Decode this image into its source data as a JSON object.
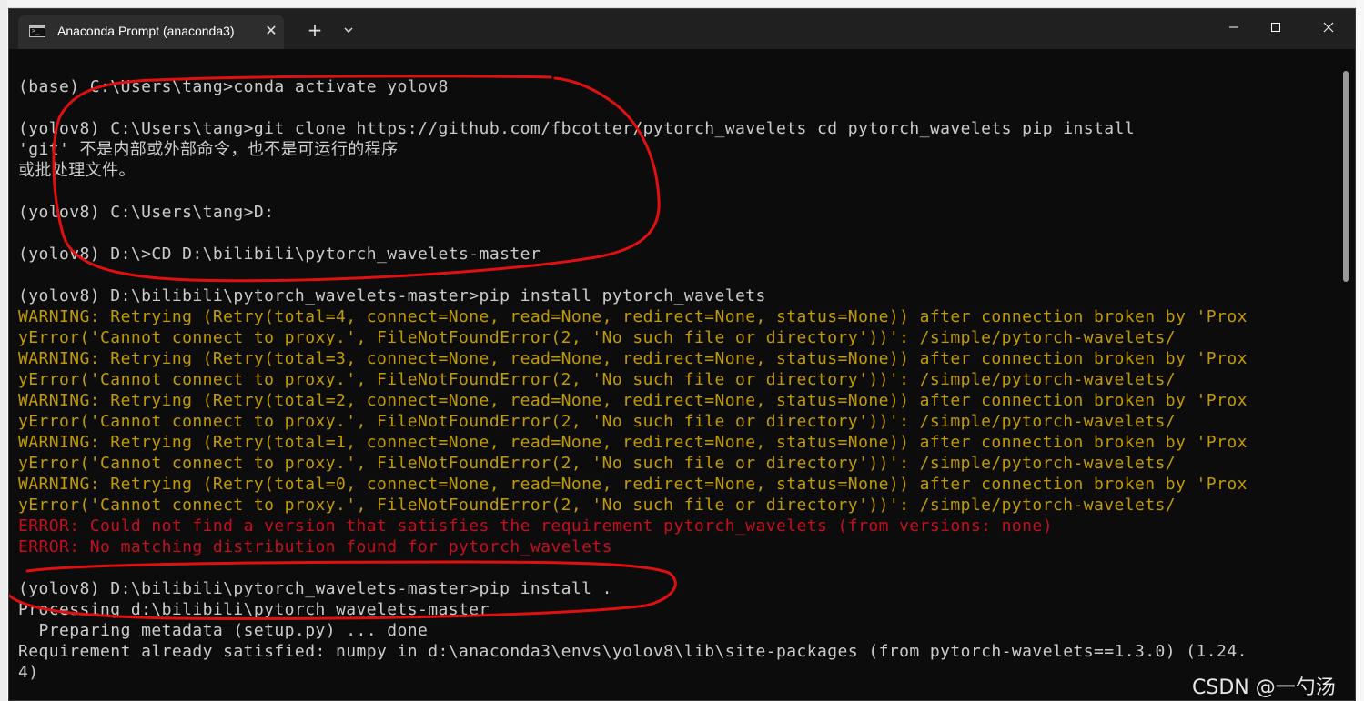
{
  "window": {
    "tab_title": "Anaconda Prompt (anaconda3)",
    "tab_close": "✕",
    "new_tab": "+",
    "minimize": "─",
    "maximize": "☐",
    "close": "✕"
  },
  "terminal_lines": [
    {
      "text": "(base) C:\\Users\\tang>conda activate yolov8",
      "type": "normal"
    },
    {
      "text": "",
      "type": "normal"
    },
    {
      "text": "(yolov8) C:\\Users\\tang>git clone https://github.com/fbcotter/pytorch_wavelets cd pytorch_wavelets pip install",
      "type": "normal"
    },
    {
      "text": "'git' 不是内部或外部命令，也不是可运行的程序",
      "type": "normal"
    },
    {
      "text": "或批处理文件。",
      "type": "normal"
    },
    {
      "text": "",
      "type": "normal"
    },
    {
      "text": "(yolov8) C:\\Users\\tang>D:",
      "type": "normal"
    },
    {
      "text": "",
      "type": "normal"
    },
    {
      "text": "(yolov8) D:\\>CD D:\\bilibili\\pytorch_wavelets-master",
      "type": "normal"
    },
    {
      "text": "",
      "type": "normal"
    },
    {
      "text": "(yolov8) D:\\bilibili\\pytorch_wavelets-master>pip install pytorch_wavelets",
      "type": "normal"
    },
    {
      "text": "WARNING: Retrying (Retry(total=4, connect=None, read=None, redirect=None, status=None)) after connection broken by 'Prox",
      "type": "warn"
    },
    {
      "text": "yError('Cannot connect to proxy.', FileNotFoundError(2, 'No such file or directory'))': /simple/pytorch-wavelets/",
      "type": "warn"
    },
    {
      "text": "WARNING: Retrying (Retry(total=3, connect=None, read=None, redirect=None, status=None)) after connection broken by 'Prox",
      "type": "warn"
    },
    {
      "text": "yError('Cannot connect to proxy.', FileNotFoundError(2, 'No such file or directory'))': /simple/pytorch-wavelets/",
      "type": "warn"
    },
    {
      "text": "WARNING: Retrying (Retry(total=2, connect=None, read=None, redirect=None, status=None)) after connection broken by 'Prox",
      "type": "warn"
    },
    {
      "text": "yError('Cannot connect to proxy.', FileNotFoundError(2, 'No such file or directory'))': /simple/pytorch-wavelets/",
      "type": "warn"
    },
    {
      "text": "WARNING: Retrying (Retry(total=1, connect=None, read=None, redirect=None, status=None)) after connection broken by 'Prox",
      "type": "warn"
    },
    {
      "text": "yError('Cannot connect to proxy.', FileNotFoundError(2, 'No such file or directory'))': /simple/pytorch-wavelets/",
      "type": "warn"
    },
    {
      "text": "WARNING: Retrying (Retry(total=0, connect=None, read=None, redirect=None, status=None)) after connection broken by 'Prox",
      "type": "warn"
    },
    {
      "text": "yError('Cannot connect to proxy.', FileNotFoundError(2, 'No such file or directory'))': /simple/pytorch-wavelets/",
      "type": "warn"
    },
    {
      "text": "ERROR: Could not find a version that satisfies the requirement pytorch_wavelets (from versions: none)",
      "type": "error"
    },
    {
      "text": "ERROR: No matching distribution found for pytorch_wavelets",
      "type": "error"
    },
    {
      "text": "",
      "type": "normal"
    },
    {
      "text": "(yolov8) D:\\bilibili\\pytorch_wavelets-master>pip install .",
      "type": "normal"
    },
    {
      "text": "Processing d:\\bilibili\\pytorch_wavelets-master",
      "type": "normal"
    },
    {
      "text": "  Preparing metadata (setup.py) ... done",
      "type": "normal"
    },
    {
      "text": "Requirement already satisfied: numpy in d:\\anaconda3\\envs\\yolov8\\lib\\site-packages (from pytorch-wavelets==1.3.0) (1.24.",
      "type": "normal"
    },
    {
      "text": "4)",
      "type": "normal"
    }
  ],
  "watermark": "CSDN @一勺汤",
  "colors": {
    "terminal_bg": "#0c0c0c",
    "normal": "#cccccc",
    "warn": "#c19c00",
    "error": "#c50f1f",
    "annotation": "#e01010"
  },
  "icons": {
    "tab_icon": "terminal-icon",
    "dropdown": "chevron-down-icon"
  }
}
